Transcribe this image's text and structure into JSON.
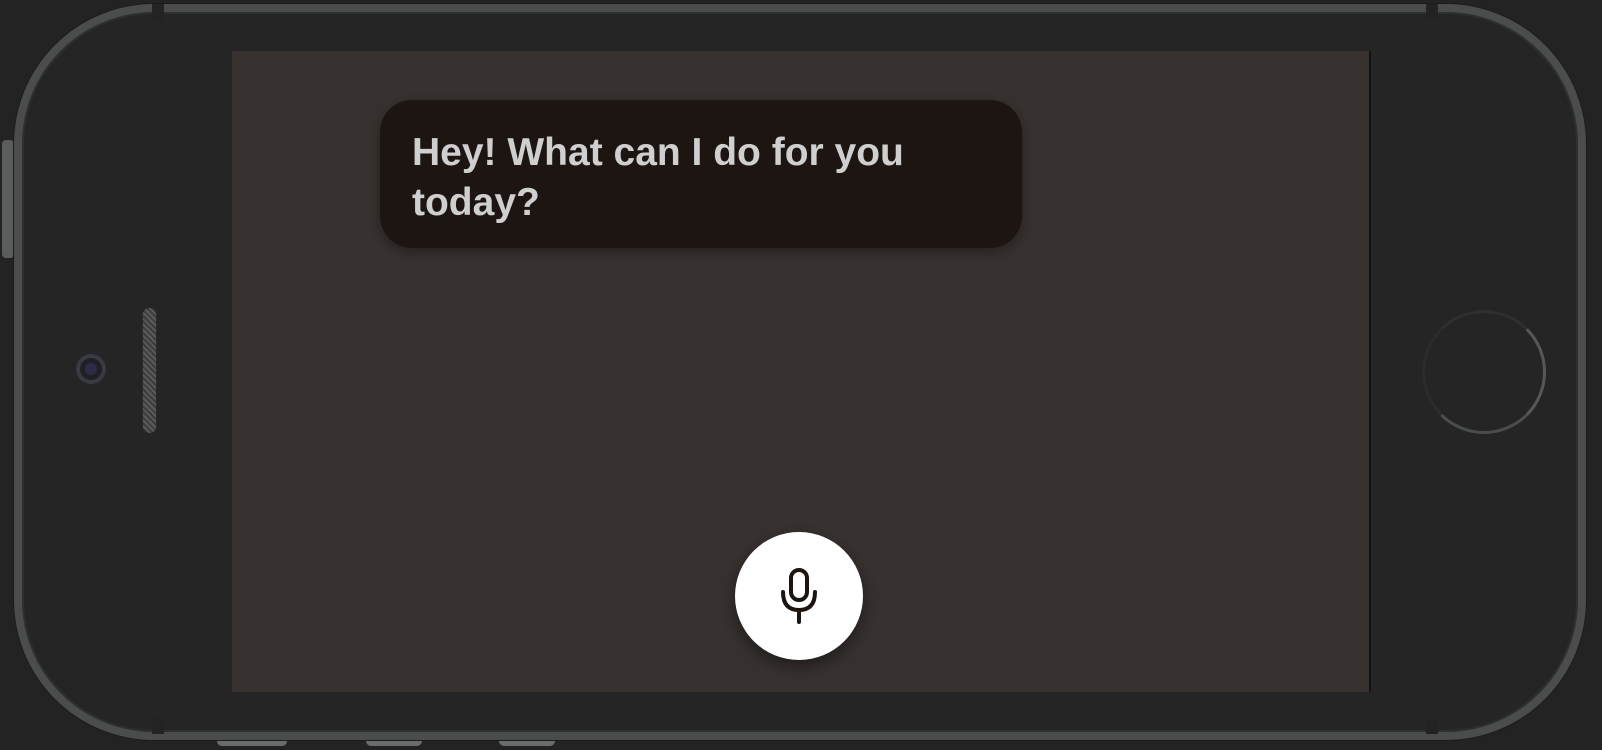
{
  "assistant": {
    "message": "Hey! What can I do for you today?"
  },
  "controls": {
    "mic_label": "microphone"
  },
  "colors": {
    "screen_background": "#373230",
    "bubble_background": "#1d1511",
    "bubble_text": "#cfcfcf",
    "mic_button": "#ffffff",
    "mic_icon": "#1d1511"
  }
}
